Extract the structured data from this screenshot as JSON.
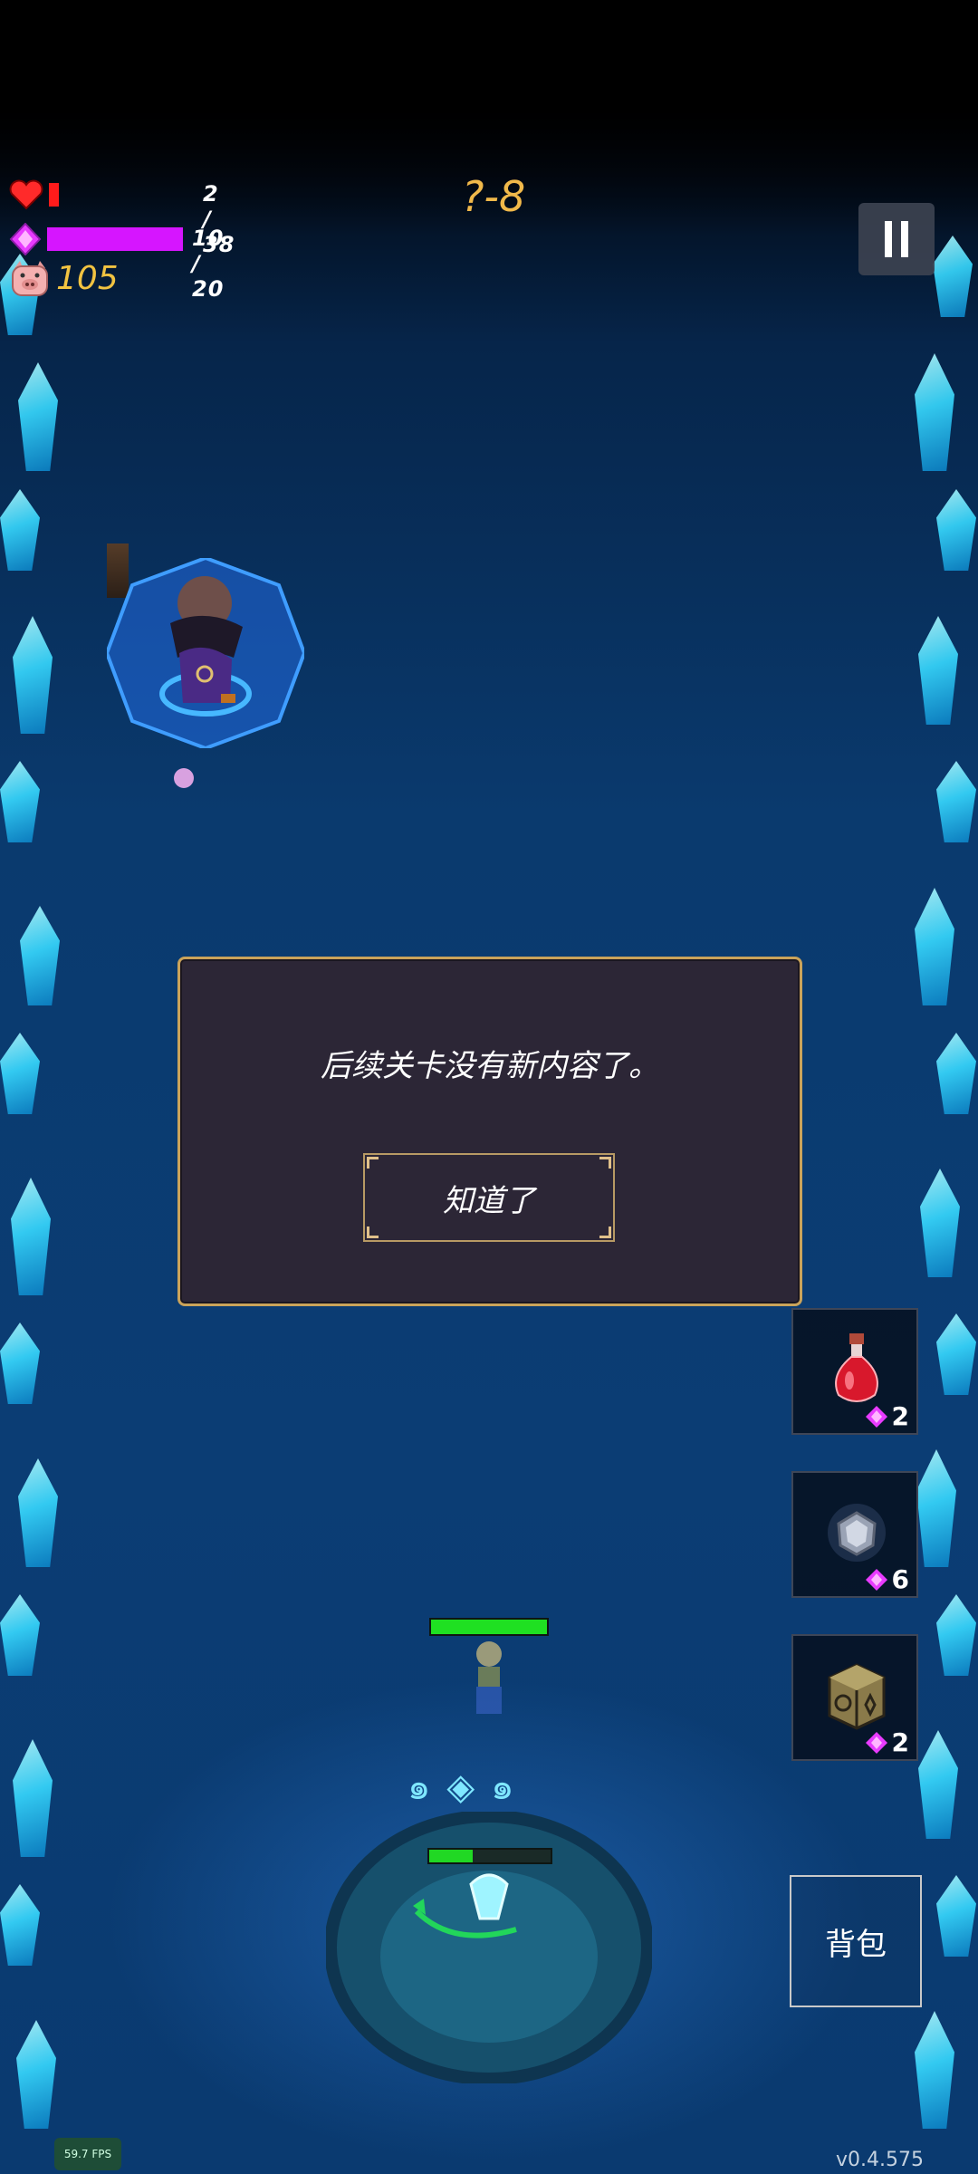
{
  "hud": {
    "hp_text": "2 / 38",
    "hp_value": 2,
    "hp_max": 38,
    "mp_text": "10 / 20",
    "mp_value": 10,
    "mp_max": 20,
    "gold": "105",
    "stage": "?-8",
    "colors": {
      "hp": "#ff1b1b",
      "mp": "#d615ff",
      "gold": "#f2c341",
      "stage": "#f1b94a"
    }
  },
  "dialog": {
    "message": "后续关卡没有新内容了。",
    "ok_label": "知道了"
  },
  "items": [
    {
      "icon": "potion-icon",
      "count": "2"
    },
    {
      "icon": "ore-orb-icon",
      "count": "6"
    },
    {
      "icon": "rune-crate-icon",
      "count": "2"
    }
  ],
  "bag_label": "背包",
  "player": {
    "hp_fraction": 1.0
  },
  "base": {
    "hp_fraction": 0.36
  },
  "fps": "59.7 FPS",
  "version": "v0.4.575"
}
